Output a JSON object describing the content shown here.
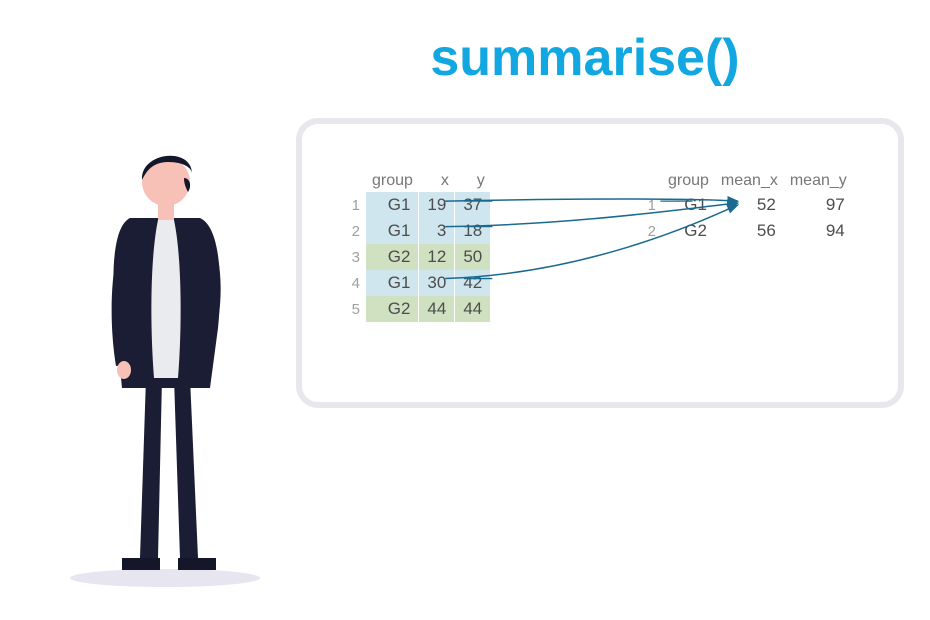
{
  "title": "summarise()",
  "colors": {
    "title": "#12a7e1",
    "g1_row": "#cfe6ef",
    "g2_row": "#cfe1c0",
    "panel_border": "#e6e8eb",
    "arrow": "#1a6a8f"
  },
  "left_table": {
    "headers": [
      "group",
      "x",
      "y"
    ],
    "rows": [
      {
        "n": "1",
        "group": "G1",
        "x": "19",
        "y": "37",
        "class": "g1"
      },
      {
        "n": "2",
        "group": "G1",
        "x": "3",
        "y": "18",
        "class": "g1"
      },
      {
        "n": "3",
        "group": "G2",
        "x": "12",
        "y": "50",
        "class": "g2"
      },
      {
        "n": "4",
        "group": "G1",
        "x": "30",
        "y": "42",
        "class": "g1"
      },
      {
        "n": "5",
        "group": "G2",
        "x": "44",
        "y": "44",
        "class": "g2"
      }
    ]
  },
  "right_table": {
    "headers": [
      "group",
      "mean_x",
      "mean_y"
    ],
    "rows": [
      {
        "n": "1",
        "group": "G1",
        "mean_x": "52",
        "mean_y": "97"
      },
      {
        "n": "2",
        "group": "G2",
        "mean_x": "56",
        "mean_y": "94"
      }
    ]
  }
}
